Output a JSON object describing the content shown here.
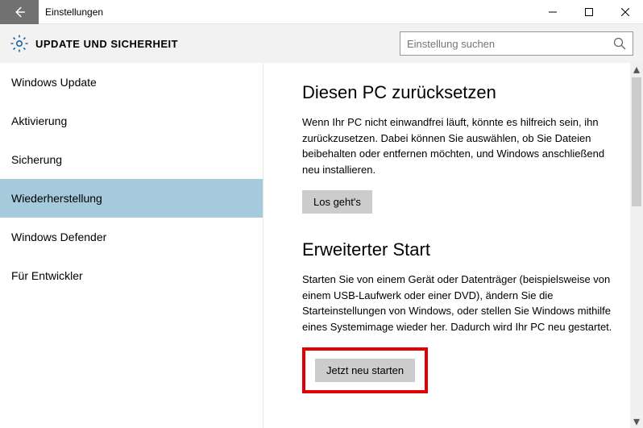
{
  "titlebar": {
    "title": "Einstellungen"
  },
  "header": {
    "title": "UPDATE UND SICHERHEIT",
    "search_placeholder": "Einstellung suchen"
  },
  "sidebar": {
    "items": [
      {
        "label": "Windows Update"
      },
      {
        "label": "Aktivierung"
      },
      {
        "label": "Sicherung"
      },
      {
        "label": "Wiederherstellung"
      },
      {
        "label": "Windows Defender"
      },
      {
        "label": "Für Entwickler"
      }
    ],
    "selected_index": 3
  },
  "content": {
    "section1": {
      "title": "Diesen PC zurücksetzen",
      "text": "Wenn Ihr PC nicht einwandfrei läuft, könnte es hilfreich sein, ihn zurückzusetzen. Dabei können Sie auswählen, ob Sie Dateien beibehalten oder entfernen möchten, und Windows anschließend neu installieren.",
      "button": "Los geht's"
    },
    "section2": {
      "title": "Erweiterter Start",
      "text": "Starten Sie von einem Gerät oder Datenträger (beispielsweise von einem USB-Laufwerk oder einer DVD), ändern Sie die Starteinstellungen von Windows, oder stellen Sie Windows mithilfe eines Systemimage wieder her. Dadurch wird Ihr PC neu gestartet.",
      "button": "Jetzt neu starten"
    }
  }
}
